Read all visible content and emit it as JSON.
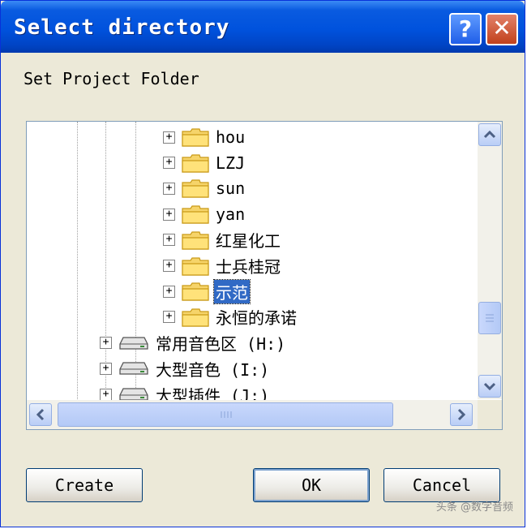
{
  "window": {
    "title": "Select directory",
    "help_glyph": "?",
    "close_glyph": "✕"
  },
  "dialog": {
    "label": "Set Project Folder"
  },
  "tree": {
    "items": [
      {
        "label": "hou",
        "type": "folder",
        "selected": false
      },
      {
        "label": "LZJ",
        "type": "folder",
        "selected": false
      },
      {
        "label": "sun",
        "type": "folder",
        "selected": false
      },
      {
        "label": "yan",
        "type": "folder",
        "selected": false
      },
      {
        "label": "红星化工",
        "type": "folder",
        "selected": false
      },
      {
        "label": "士兵桂冠",
        "type": "folder",
        "selected": false
      },
      {
        "label": "示范",
        "type": "folder",
        "selected": true
      },
      {
        "label": "永恒的承诺",
        "type": "folder",
        "selected": false
      },
      {
        "label": "常用音色区  (H:)",
        "type": "drive",
        "selected": false
      },
      {
        "label": "大型音色  (I:)",
        "type": "drive",
        "selected": false
      },
      {
        "label": "大型插件  (J:)",
        "type": "drive",
        "selected": false
      }
    ],
    "expander_glyph": "+"
  },
  "buttons": {
    "create": "Create",
    "ok": "OK",
    "cancel": "Cancel"
  },
  "watermark": "头条 @数字音频",
  "colors": {
    "titlebar": "#0052dd",
    "selection": "#316ac5",
    "face": "#ece9d8"
  }
}
